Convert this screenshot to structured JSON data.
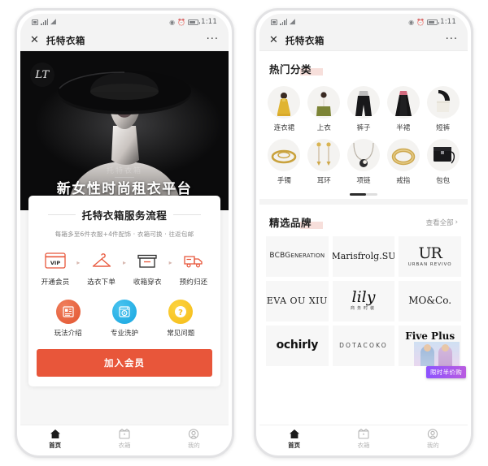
{
  "statusbar": {
    "time": "1:11",
    "icons": [
      "sim-card-icon",
      "signal-bars-icon",
      "wifi-icon",
      "eye-icon",
      "alarm-icon",
      "battery-icon"
    ]
  },
  "titlebar": {
    "close_label": "✕",
    "title": "托特衣箱",
    "more_label": "···"
  },
  "left_phone": {
    "hero": {
      "logo": "LT",
      "watermark": "托特衣箱",
      "title": "新女性时尚租衣平台"
    },
    "service_card": {
      "title": "托特衣箱服务流程",
      "subtitle": "每箱多至6件衣服+4件配饰 · 衣箱可换 · 往返包邮",
      "arrow": "▸",
      "steps": [
        {
          "icon": "vip-card-icon",
          "label": "开通会员"
        },
        {
          "icon": "clothes-hanger-icon",
          "label": "选衣下单"
        },
        {
          "icon": "open-box-icon",
          "label": "收箱穿衣"
        },
        {
          "icon": "delivery-truck-icon",
          "label": "预约归还"
        }
      ]
    },
    "quick_links": [
      {
        "icon": "document-list-icon",
        "label": "玩法介绍",
        "color": "#e2542f"
      },
      {
        "icon": "washing-machine-icon",
        "label": "专业洗护",
        "color": "#17a6e0"
      },
      {
        "icon": "question-mark-icon",
        "label": "常见问题",
        "color": "#f5bc18"
      }
    ],
    "cta_label": "加入会员",
    "cta_color": "#e8563a"
  },
  "right_phone": {
    "categories_section": {
      "title": "热门分类",
      "items": [
        {
          "label": "连衣裙",
          "icon": "dress-icon"
        },
        {
          "label": "上衣",
          "icon": "top-icon"
        },
        {
          "label": "裤子",
          "icon": "trousers-icon"
        },
        {
          "label": "半裙",
          "icon": "skirt-icon"
        },
        {
          "label": "短裤",
          "icon": "shorts-icon"
        },
        {
          "label": "手镯",
          "icon": "bracelet-icon"
        },
        {
          "label": "耳环",
          "icon": "earrings-icon"
        },
        {
          "label": "项链",
          "icon": "necklace-icon"
        },
        {
          "label": "戒指",
          "icon": "ring-icon"
        },
        {
          "label": "包包",
          "icon": "handbag-icon"
        }
      ]
    },
    "brands_section": {
      "title": "精选品牌",
      "more_label": "查看全部",
      "more_chevron": "›",
      "brands": [
        {
          "name": "BCBGeneration",
          "main": "BCBG",
          "sub": "ENERATION"
        },
        {
          "name": "Marisfrolg.SU",
          "main": "Marisfrolg.SU",
          "sub": ""
        },
        {
          "name": "URBAN REVIVO",
          "main": "UR",
          "sub": "URBAN REVIVO"
        },
        {
          "name": "EVA OU XIU",
          "main": "EVA OU XIU",
          "sub": ""
        },
        {
          "name": "lily",
          "main": "lily",
          "sub": "商务时装"
        },
        {
          "name": "MO&Co.",
          "main": "MO&Co.",
          "sub": ""
        },
        {
          "name": "ochirly",
          "main": "ochirly",
          "sub": ""
        },
        {
          "name": "DOTACOKO",
          "main": "DOTACOKO",
          "sub": ""
        },
        {
          "name": "Five Plus",
          "main": "Five Plus",
          "sub": ""
        }
      ],
      "promo_badge": "限时半价购",
      "promo_color": "#8c52ff"
    }
  },
  "tabbar": {
    "items": [
      {
        "label": "首页",
        "icon": "home-icon",
        "active": true
      },
      {
        "label": "衣箱",
        "icon": "box-icon",
        "active": false
      },
      {
        "label": "我的",
        "icon": "profile-icon",
        "active": false
      }
    ]
  }
}
